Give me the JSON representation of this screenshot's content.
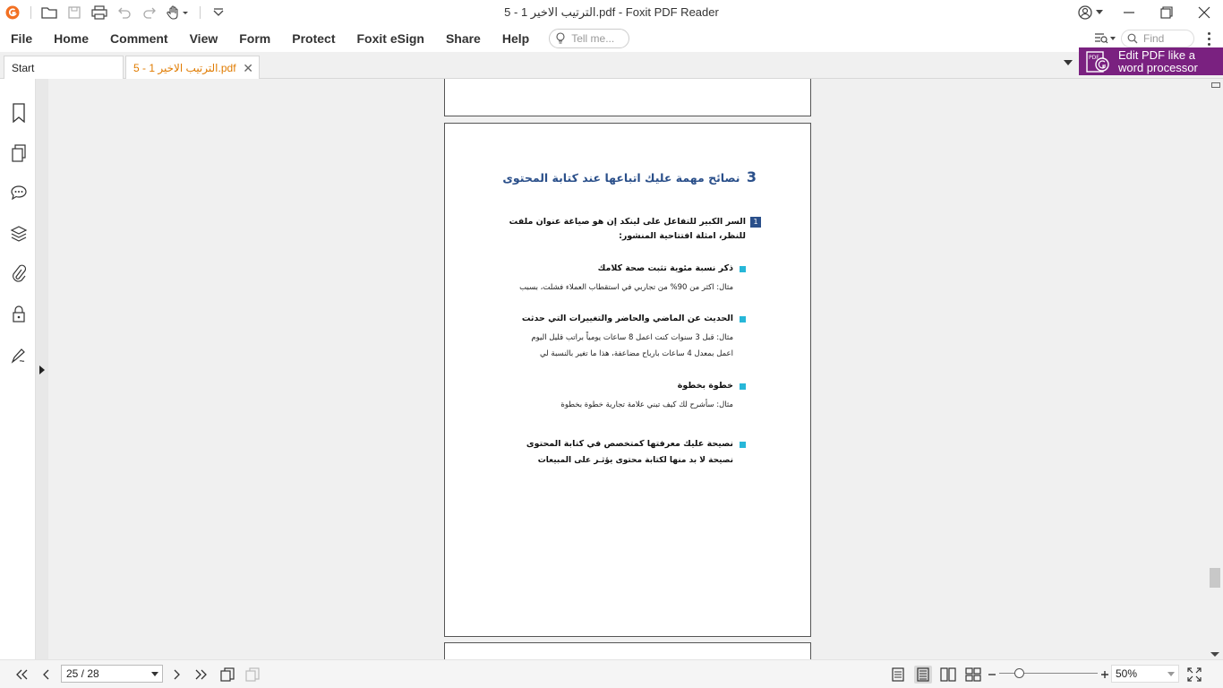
{
  "window": {
    "title": "5 - 1 الترتيب الاخير.pdf - Foxit PDF Reader"
  },
  "quick_access": {
    "icons": [
      "foxit-logo-icon",
      "open-folder-icon",
      "save-icon",
      "print-icon",
      "undo-icon",
      "redo-icon",
      "hand-tool-icon",
      "customize-dropdown-icon"
    ]
  },
  "menu": {
    "items": [
      "File",
      "Home",
      "Comment",
      "View",
      "Form",
      "Protect",
      "Foxit eSign",
      "Share",
      "Help"
    ],
    "tell_me_placeholder": "Tell me...",
    "find_placeholder": "Find"
  },
  "tabs": {
    "start_label": "Start",
    "doc_label": "5 - 1 الترتيب الاخير.pdf"
  },
  "promo": {
    "line1": "Edit PDF like a",
    "line2": "word processor",
    "accent": "#7a2180"
  },
  "left_panel": {
    "icons": [
      "bookmark-icon",
      "pages-icon",
      "comments-icon",
      "layers-icon",
      "attachments-icon",
      "security-icon",
      "signature-icon"
    ]
  },
  "page_content": {
    "title_number": "3",
    "title": "نصائح مهمة عليك اتباعها عند كتابة المحتوى",
    "lead_badge": "1",
    "lead_line1": "السر الكبير للتفاعل على لينكد إن هو صياغة عنوان ملفت",
    "lead_line2": "للنظر، امثلة افتتاحية المنشور:",
    "tips": [
      {
        "heading": "ذكر نسبة مئوية تثبت صحة كلامك",
        "lines": [
          "مثال: اكثر من 90% من تجاربي في استقطاب العملاء فشلت، بسبب"
        ]
      },
      {
        "heading": "الحديث عن الماضي والحاضر والتغييرات التي حدثت",
        "lines": [
          "مثال: قبل 3 سنوات كنت اعمل 8 ساعات يومياً براتب قليل اليوم",
          "اعمل بمعدل 4 ساعات بارباح مضاعفة، هذا ما تغير بالنسبة لي"
        ]
      },
      {
        "heading": "خطوة بخطوة",
        "lines": [
          "مثال: سأشرح لك كيف تبني علامة تجارية خطوة بخطوة"
        ]
      },
      {
        "heading": "نصيحة عليك معرفتها كمتخصص في كتابة المحتوى",
        "lines": [
          "نصيحة لا بد منها لكتابة محتوى يؤثـر على المبيعات"
        ]
      }
    ],
    "colors": {
      "title": "#2a4f8a",
      "bullet": "#27b7d8"
    }
  },
  "status": {
    "page_indicator": "25 / 28",
    "zoom": "50%",
    "zoom_fraction": 0.2
  }
}
